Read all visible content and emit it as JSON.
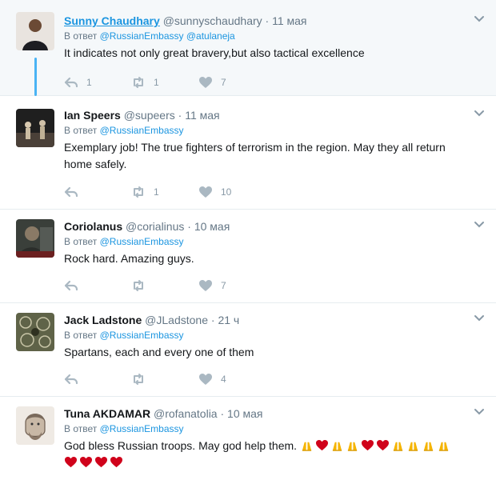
{
  "reply_prefix": "В ответ",
  "tweets": [
    {
      "name": "Sunny Chaudhary",
      "handle": "@sunnyschaudhary",
      "dot": "·",
      "time": "11 мая",
      "mentions": [
        "@RussianEmbassy",
        "@atulaneja"
      ],
      "text": "It indicates not only great bravery,but also tactical excellence",
      "reply_count": "1",
      "retweet_count": "1",
      "like_count": "7"
    },
    {
      "name": "Ian Speers",
      "handle": "@supeers",
      "dot": "·",
      "time": "11 мая",
      "mentions": [
        "@RussianEmbassy"
      ],
      "text_line1": "Exemplary job! The true fighters of terrorism in the region. May they all return",
      "text_line2": "home safely.",
      "reply_count": "",
      "retweet_count": "1",
      "like_count": "10"
    },
    {
      "name": "Coriolanus",
      "handle": "@corialinus",
      "dot": "·",
      "time": "10 мая",
      "mentions": [
        "@RussianEmbassy"
      ],
      "text": "Rock hard. Amazing guys.",
      "reply_count": "",
      "retweet_count": "",
      "like_count": "7"
    },
    {
      "name": "Jack Ladstone",
      "handle": "@JLadstone",
      "dot": "·",
      "time": "21 ч",
      "mentions": [
        "@RussianEmbassy"
      ],
      "text": "Spartans, each and every one of them",
      "reply_count": "",
      "retweet_count": "",
      "like_count": "4"
    },
    {
      "name": "Tuna AKDAMAR",
      "handle": "@rofanatolia",
      "dot": "·",
      "time": "10 мая",
      "mentions": [
        "@RussianEmbassy"
      ],
      "text": "God bless Russian troops. May god help them.",
      "emoji_line1": [
        "hands",
        "heart",
        "hands",
        "hands",
        "heart",
        "heart",
        "hands",
        "hands",
        "hands",
        "hands"
      ],
      "emoji_line2": [
        "heart",
        "heart",
        "heart",
        "heart"
      ]
    }
  ],
  "icons": {
    "reply": "reply-arrow-icon",
    "retweet": "retweet-icon",
    "like": "heart-icon",
    "more": "chevron-down-icon"
  },
  "colors": {
    "link": "#1b95e0",
    "thread": "#4ab3f4",
    "highlight_bg": "#f5f8fa",
    "muted": "#657786",
    "icon": "#aab8c2"
  }
}
